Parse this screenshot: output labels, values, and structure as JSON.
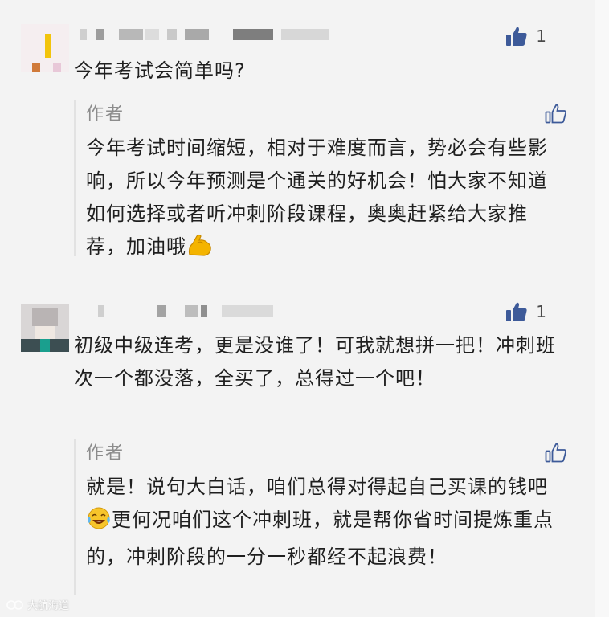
{
  "comments": [
    {
      "like_count": "1",
      "text": "今年考试会简单吗?",
      "reply": {
        "author": "作者",
        "text": "今年考试时间缩短，相对于难度而言，势必会有些影响，所以今年预测是个通关的好机会！怕大家不知道如何选择或者听冲刺阶段课程，奥奥赶紧给大家推荐，加油哦"
      }
    },
    {
      "like_count": "1",
      "text": "初级中级连考，更是没谁了！可我就想拼一把！冲刺班次一个都没落，全买了，总得过一个吧！",
      "reply": {
        "author": "作者",
        "text_before_emoji": "就是！说句大白话，咱们总得对得起自己买课的钱吧",
        "text_after_emoji": "更何况咱们这个冲刺班，就是帮你省时间提炼重点的，冲刺阶段的一分一秒都经不起浪费！"
      }
    }
  ],
  "icons": {
    "like_filled": "thumbs-up-filled-icon",
    "like_outline": "thumbs-up-outline-icon",
    "emoji_flex": "flexed-biceps-emoji",
    "emoji_laugh": "tears-of-joy-emoji"
  },
  "colors": {
    "background": "#f3f3f3",
    "like_blue": "#3d5a99",
    "muted_text": "#8c8c8c"
  },
  "watermark": "大航海道"
}
